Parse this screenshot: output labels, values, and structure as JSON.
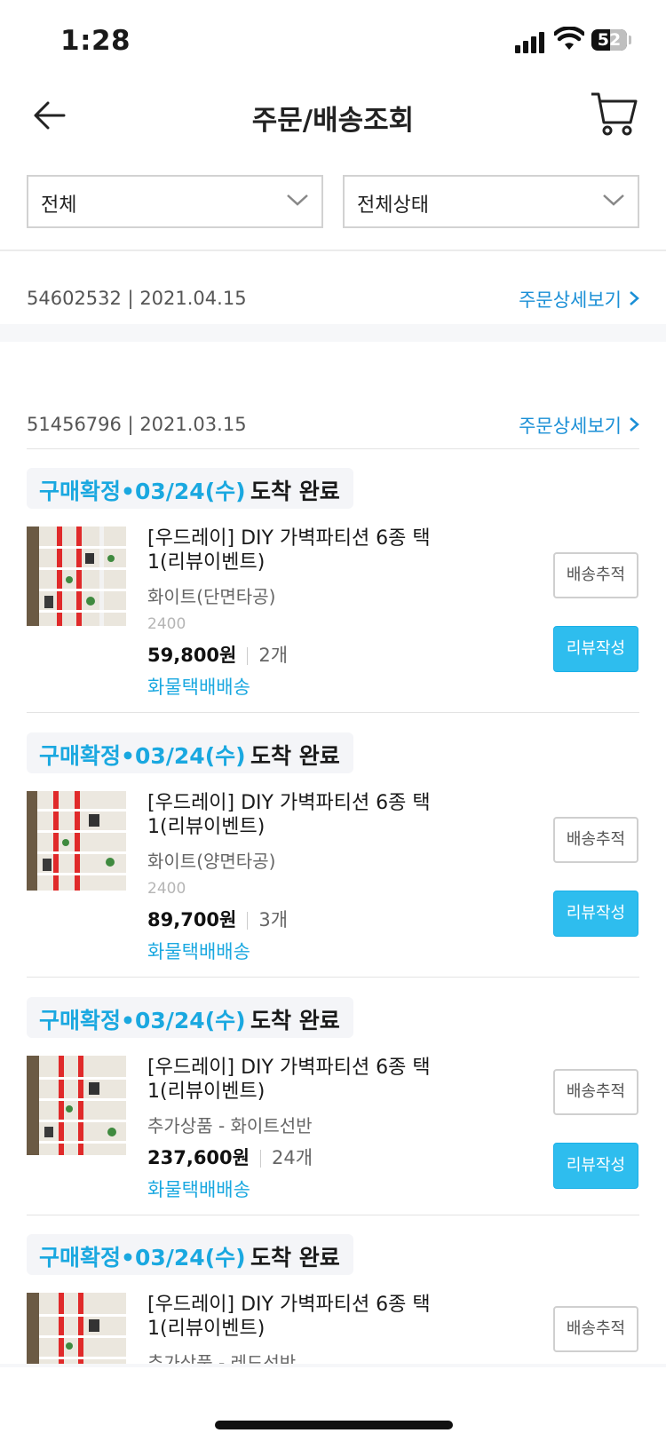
{
  "status_bar": {
    "time": "1:28",
    "battery": "52"
  },
  "header": {
    "title": "주문/배송조회"
  },
  "filters": [
    {
      "label": "전체"
    },
    {
      "label": "전체상태"
    }
  ],
  "orders": [
    {
      "id_date": "54602532 | 2021.04.15",
      "detail_link": "주문상세보기"
    },
    {
      "id_date": "51456796 | 2021.03.15",
      "detail_link": "주문상세보기"
    }
  ],
  "items": [
    {
      "status_prefix": "구매확정•03/24(수)",
      "status_suffix": "도착 완료",
      "name": "[우드레이]  DIY 가벽파티션 6종 택1(리뷰이벤트)",
      "option": "화이트(단면타공)",
      "code": "2400",
      "price": "59,800원",
      "qty": "2개",
      "shipping": "화물택배배송",
      "track_label": "배송추적",
      "review_label": "리뷰작성"
    },
    {
      "status_prefix": "구매확정•03/24(수)",
      "status_suffix": "도착 완료",
      "name": "[우드레이]  DIY 가벽파티션 6종 택1(리뷰이벤트)",
      "option": "화이트(양면타공)",
      "code": "2400",
      "price": "89,700원",
      "qty": "3개",
      "shipping": "화물택배배송",
      "track_label": "배송추적",
      "review_label": "리뷰작성"
    },
    {
      "status_prefix": "구매확정•03/24(수)",
      "status_suffix": "도착 완료",
      "name": "[우드레이]  DIY 가벽파티션 6종 택1(리뷰이벤트)",
      "option": "추가상품 - 화이트선반",
      "price": "237,600원",
      "qty": "24개",
      "shipping": "화물택배배송",
      "track_label": "배송추적",
      "review_label": "리뷰작성"
    },
    {
      "status_prefix": "구매확정•03/24(수)",
      "status_suffix": "도착 완료",
      "name": "[우드레이]  DIY 가벽파티션 6종 택1(리뷰이벤트)",
      "option": "추가상품 - 레드선반",
      "track_label": "배송추적"
    }
  ]
}
